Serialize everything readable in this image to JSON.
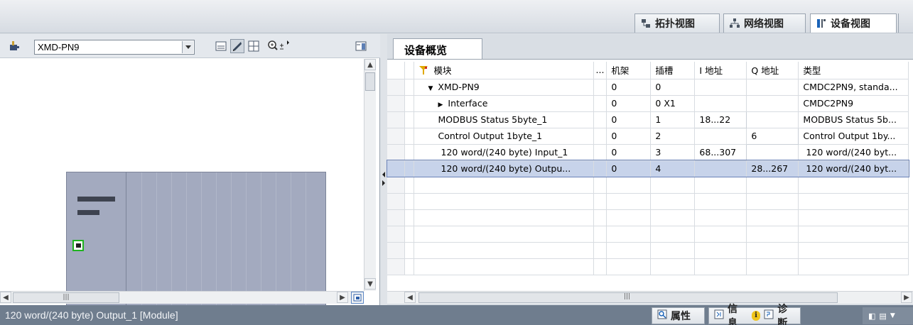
{
  "view_tabs": [
    {
      "label": "拓扑视图",
      "icon": "topology-icon"
    },
    {
      "label": "网络视图",
      "icon": "network-icon"
    },
    {
      "label": "设备视图",
      "icon": "device-icon"
    }
  ],
  "left": {
    "device_select": "XMD-PN9"
  },
  "right": {
    "overview_tab": "设备概览",
    "columns": [
      "",
      "模块",
      "...",
      "机架",
      "插槽",
      "I 地址",
      "Q 地址",
      "类型"
    ],
    "rows": [
      {
        "module": "XMD-PN9",
        "rack": "0",
        "slot": "0",
        "i_addr": "",
        "q_addr": "",
        "type": "CMDC2PN9, standa..."
      },
      {
        "module": "Interface",
        "rack": "0",
        "slot": "0 X1",
        "i_addr": "",
        "q_addr": "",
        "type": "CMDC2PN9"
      },
      {
        "module": "MODBUS Status 5byte_1",
        "rack": "0",
        "slot": "1",
        "i_addr": "18...22",
        "q_addr": "",
        "type": "MODBUS Status 5b..."
      },
      {
        "module": "Control Output 1byte_1",
        "rack": "0",
        "slot": "2",
        "i_addr": "",
        "q_addr": "6",
        "type": "Control Output 1by..."
      },
      {
        "module": "120 word/(240 byte) Input_1",
        "rack": "0",
        "slot": "3",
        "i_addr": "68...307",
        "q_addr": "",
        "type": "120 word/(240 byt..."
      },
      {
        "module": "120 word/(240 byte) Outpu...",
        "rack": "0",
        "slot": "4",
        "i_addr": "",
        "q_addr": "28...267",
        "type": "120 word/(240 byt..."
      }
    ]
  },
  "status": {
    "text": "120 word/(240 byte) Output_1 [Module]",
    "tabs": [
      {
        "label": "属性",
        "icon": "properties-icon"
      },
      {
        "label": "信息",
        "icon": "info-icon"
      },
      {
        "label": "诊断",
        "icon": "diagnostics-icon"
      }
    ]
  }
}
